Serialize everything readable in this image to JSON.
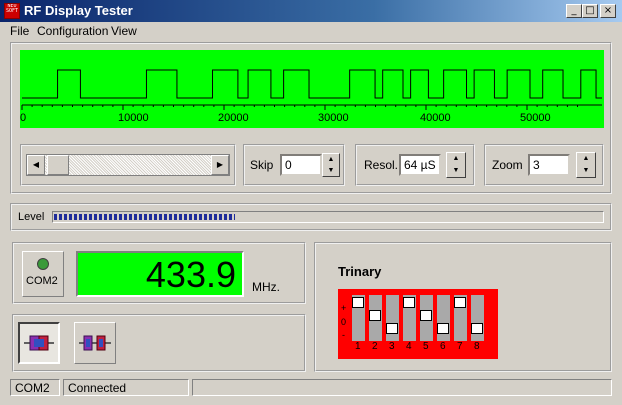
{
  "window": {
    "title": "RF Display Tester",
    "icon_text": "NEO SOFT",
    "buttons": {
      "minimize": "_",
      "maximize": "□",
      "close": "×"
    }
  },
  "menu": [
    "File",
    "Configuration",
    "View"
  ],
  "scope": {
    "ticks": [
      "0",
      "10000",
      "20000",
      "30000",
      "40000",
      "50000"
    ],
    "pulses": [
      [
        28,
        46
      ],
      [
        98,
        122
      ],
      [
        150,
        170
      ],
      [
        178,
        196
      ],
      [
        206,
        226
      ],
      [
        258,
        278
      ],
      [
        284,
        300
      ],
      [
        306,
        320
      ],
      [
        332,
        350
      ],
      [
        356,
        372
      ],
      [
        382,
        400
      ],
      [
        410,
        426
      ],
      [
        440,
        452
      ]
    ]
  },
  "controls": {
    "skip": {
      "label": "Skip",
      "value": "0"
    },
    "resol": {
      "label": "Resol.",
      "value": "64 µS"
    },
    "zoom": {
      "label": "Zoom",
      "value": "3"
    }
  },
  "level": {
    "label": "Level",
    "fraction": 0.33
  },
  "port": {
    "label": "COM2",
    "led_color": "#3a9a3a"
  },
  "frequency": {
    "value": "433.9",
    "unit": "MHz."
  },
  "trinary": {
    "title": "Trinary",
    "scale_plus": "+",
    "scale_zero": "0",
    "scale_minus": "-",
    "switches": [
      {
        "num": "1",
        "state": "+"
      },
      {
        "num": "2",
        "state": "0"
      },
      {
        "num": "3",
        "state": "-"
      },
      {
        "num": "4",
        "state": "+"
      },
      {
        "num": "5",
        "state": "0"
      },
      {
        "num": "6",
        "state": "-"
      },
      {
        "num": "7",
        "state": "+"
      },
      {
        "num": "8",
        "state": "-"
      }
    ]
  },
  "status": {
    "port": "COM2",
    "state": "Connected",
    "extra": ""
  },
  "colors": {
    "scope_bg": "#00ff00",
    "switch_bg": "#ff0000",
    "level_fill": "#1f2c9a",
    "titlebar": "#0a246a"
  }
}
